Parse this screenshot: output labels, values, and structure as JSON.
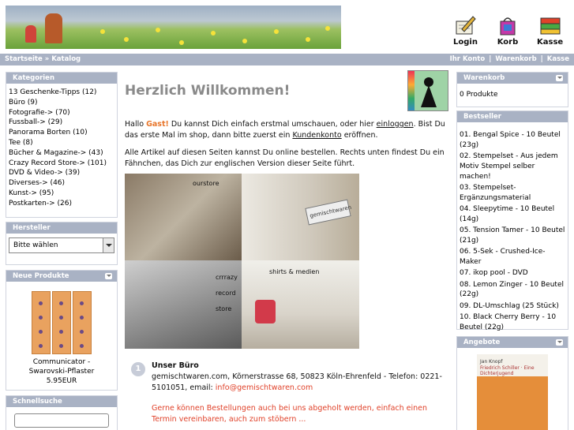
{
  "header": {
    "icons": [
      {
        "id": "login",
        "label": "Login",
        "icon": "pen-paper-icon"
      },
      {
        "id": "korb",
        "label": "Korb",
        "icon": "bag-icon"
      },
      {
        "id": "kasse",
        "label": "Kasse",
        "icon": "money-icon"
      }
    ]
  },
  "nav": {
    "crumb_home": "Startseite",
    "crumb_sep": "»",
    "crumb_catalog": "Katalog",
    "links": [
      "Ihr Konto",
      "Warenkorb",
      "Kasse"
    ]
  },
  "sidebar_left": {
    "categories_title": "Kategorien",
    "categories": [
      "13 Geschenke-Tipps (12)",
      "Büro (9)",
      "Fotografie-> (70)",
      "Fussball-> (29)",
      "Panorama Borten (10)",
      "Tee (8)",
      "Bücher & Magazine-> (43)",
      "Crazy Record Store-> (101)",
      "DVD & Video-> (39)",
      "Diverses-> (46)",
      "Kunst-> (95)",
      "Postkarten-> (26)"
    ],
    "manufacturers_title": "Hersteller",
    "manufacturers_select": "Bitte wählen",
    "new_products_title": "Neue Produkte",
    "new_product_name": "Communicator - Swarovski-Pflaster",
    "new_product_price": "5.95EUR",
    "quicksearch_title": "Schnellsuche"
  },
  "main": {
    "title": "Herzlich Willkommen!",
    "para1_a": "Hallo ",
    "para1_gast": "Gast!",
    "para1_b": " Du kannst Dich einfach erstmal umschauen, oder hier ",
    "para1_login": "einloggen",
    "para1_c": ". Bist Du das erste Mal im shop, dann bitte zuerst ein ",
    "para1_konto": "Kundenkonto",
    "para1_d": " eröffnen.",
    "para2": "Alle Artikel auf diesen Seiten kannst Du online bestellen. Rechts unten findest Du ein Fähnchen, das Dich zur englischen Version dieser Seite führt.",
    "photo_labels": {
      "ourstore": "ourstore",
      "sign": "gemischtwaren",
      "crazy1": "crrrazy",
      "crazy2": "record",
      "crazy3": "store",
      "shirts": "shirts & medien"
    },
    "office_num": "1",
    "office_title": "Unser Büro",
    "office_address": "gemischtwaren.com, Kõrnerstrasse 68, 50823 Köln-Ehrenfeld - Telefon: 0221-5101051, email: ",
    "office_email": "info@gemischtwaren.com",
    "office_note": "Gerne können Bestellungen auch bei uns abgeholt werden, einfach einen Termin vereinbaren, auch zum stöbern ..."
  },
  "sidebar_right": {
    "cart_title": "Warenkorb",
    "cart_text": "0 Produkte",
    "bestseller_title": "Bestseller",
    "bestsellers": [
      "01. Bengal Spice - 10 Beutel (23g)",
      "02. Stempelset - Aus jedem Motiv Stempel selber machen!",
      "03. Stempelset-Ergänzungsmaterial",
      "04. Sleepytime - 10 Beutel (14g)",
      "05. Tension Tamer - 10 Beutel (21g)",
      "06. 5-Sek - Crushed-Ice-Maker",
      "07. ikop pool - DVD",
      "08. Lemon Zinger - 10 Beutel (22g)",
      "09. DL-Umschlag (25 Stück)",
      "10. Black Cherry Berry - 10 Beutel (22g)"
    ],
    "offers_title": "Angebote",
    "offer_line1": "Jan Knopf",
    "offer_line2": "Friedrich Schiller · Eine Dichterjugend"
  },
  "colors": {
    "bar": "#a9b2c4",
    "accent": "#e8762b",
    "link_red": "#e0422a"
  }
}
